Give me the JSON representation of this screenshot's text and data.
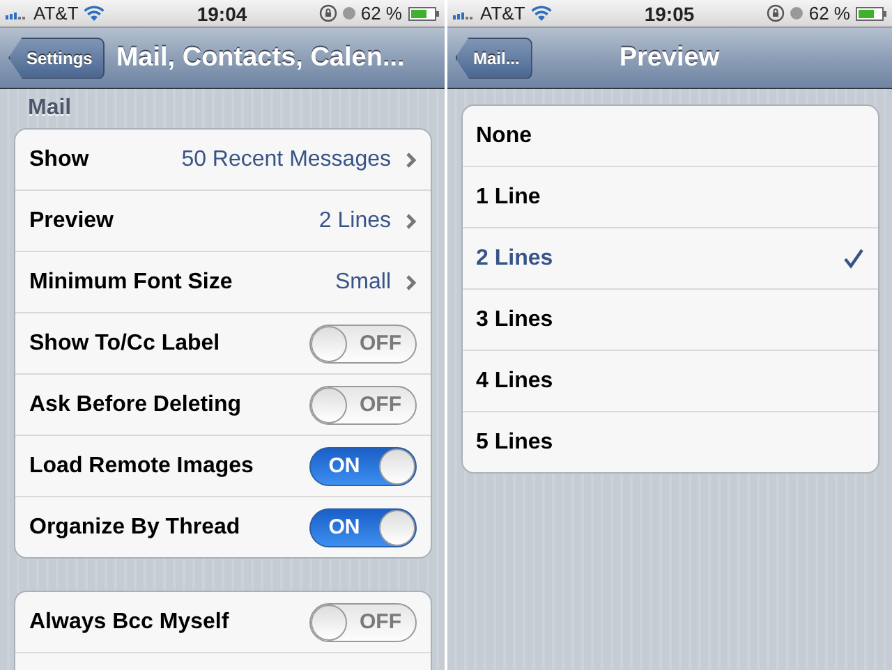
{
  "screens": [
    {
      "status_bar": {
        "carrier": "AT&T",
        "time": "19:04",
        "battery": "62 %"
      },
      "nav_bar": {
        "back": "Settings",
        "title": "Mail, Contacts, Calen..."
      },
      "section_header": "Mail",
      "groups": [
        {
          "rows": [
            {
              "kind": "disclosure",
              "label": "Show",
              "value": "50 Recent Messages"
            },
            {
              "kind": "disclosure",
              "label": "Preview",
              "value": "2 Lines"
            },
            {
              "kind": "disclosure",
              "label": "Minimum Font Size",
              "value": "Small"
            },
            {
              "kind": "switch",
              "label": "Show To/Cc Label",
              "on": false,
              "switch_text": "OFF"
            },
            {
              "kind": "switch",
              "label": "Ask Before Deleting",
              "on": false,
              "switch_text": "OFF"
            },
            {
              "kind": "switch",
              "label": "Load Remote Images",
              "on": true,
              "switch_text": "ON"
            },
            {
              "kind": "switch",
              "label": "Organize By Thread",
              "on": true,
              "switch_text": "ON"
            }
          ]
        },
        {
          "rows": [
            {
              "kind": "switch",
              "label": "Always Bcc Myself",
              "on": false,
              "switch_text": "OFF"
            }
          ],
          "continues": true
        }
      ]
    },
    {
      "status_bar": {
        "carrier": "AT&T",
        "time": "19:05",
        "battery": "62 %"
      },
      "nav_bar": {
        "back": "Mail...",
        "title": "Preview"
      },
      "groups": [
        {
          "rows": [
            {
              "kind": "option",
              "label": "None",
              "selected": false
            },
            {
              "kind": "option",
              "label": "1 Line",
              "selected": false
            },
            {
              "kind": "option",
              "label": "2 Lines",
              "selected": true
            },
            {
              "kind": "option",
              "label": "3 Lines",
              "selected": false
            },
            {
              "kind": "option",
              "label": "4 Lines",
              "selected": false
            },
            {
              "kind": "option",
              "label": "5 Lines",
              "selected": false
            }
          ]
        }
      ]
    }
  ]
}
